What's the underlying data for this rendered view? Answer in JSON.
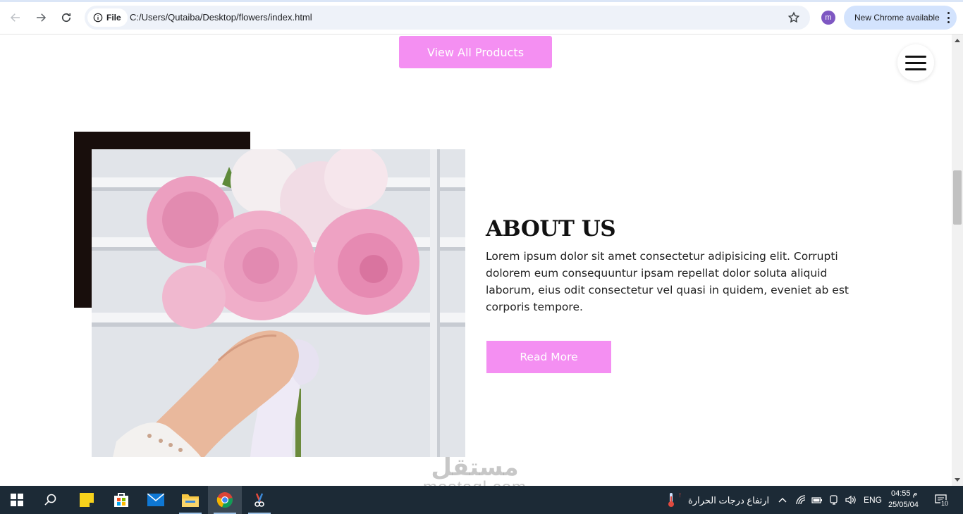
{
  "browser": {
    "site_chip": "File",
    "url": "C:/Users/Qutaiba/Desktop/flowers/index.html",
    "profile_initial": "m",
    "update_label": "New Chrome available"
  },
  "page": {
    "view_all_label": "View All Products",
    "about": {
      "title": "ABOUT US",
      "text": "Lorem ipsum dolor sit amet consectetur adipisicing elit. Corrupti dolorem eum consequuntur ipsam repellat dolor soluta aliquid laborum, eius odit consectetur vel quasi in quidem, eveniet ab est corporis tempore.",
      "read_more_label": "Read More"
    },
    "watermark": {
      "arabic": "مستقل",
      "latin": "mostaql.com"
    }
  },
  "taskbar": {
    "weather_text": "ارتفاع درجات الحرارة",
    "language": "ENG",
    "time": "04:55 م",
    "date": "25/05/04",
    "notification_count": "10"
  },
  "colors": {
    "accent_pink": "#f48ff2",
    "dark_square": "#180e0c",
    "taskbar": "#1c2a36"
  }
}
